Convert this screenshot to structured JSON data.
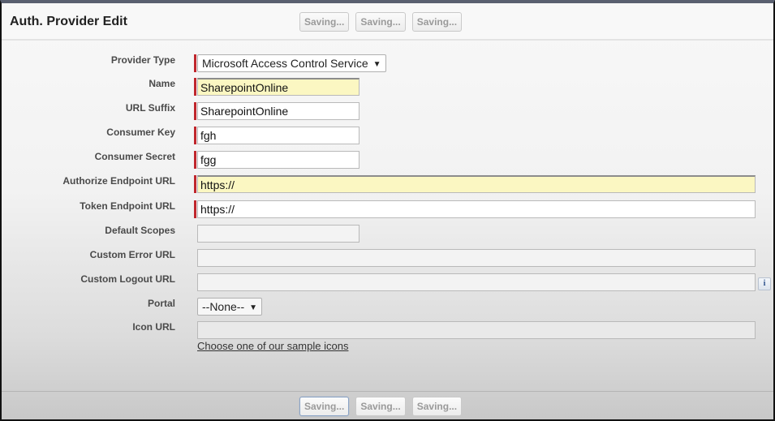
{
  "header": {
    "title": "Auth. Provider Edit",
    "buttons": [
      "Saving...",
      "Saving...",
      "Saving..."
    ]
  },
  "footer": {
    "buttons": [
      "Saving...",
      "Saving...",
      "Saving..."
    ]
  },
  "form": {
    "provider_type": {
      "label": "Provider Type",
      "value": "Microsoft Access Control Service",
      "required": true
    },
    "name": {
      "label": "Name",
      "value": "SharepointOnline",
      "required": true
    },
    "url_suffix": {
      "label": "URL Suffix",
      "value": "SharepointOnline",
      "required": true
    },
    "consumer_key": {
      "label": "Consumer Key",
      "value": "fgh",
      "required": true
    },
    "consumer_secret": {
      "label": "Consumer Secret",
      "value": "fgg",
      "required": true
    },
    "authorize_endpoint_url": {
      "label": "Authorize Endpoint URL",
      "value": "https://",
      "required": true
    },
    "token_endpoint_url": {
      "label": "Token Endpoint URL",
      "value": "https://",
      "required": true
    },
    "default_scopes": {
      "label": "Default Scopes",
      "value": ""
    },
    "custom_error_url": {
      "label": "Custom Error URL",
      "value": ""
    },
    "custom_logout_url": {
      "label": "Custom Logout URL",
      "value": "",
      "help_icon": "info-icon"
    },
    "portal": {
      "label": "Portal",
      "value": "--None--"
    },
    "icon_url": {
      "label": "Icon URL",
      "value": ""
    },
    "sample_icons_link": "Choose one of our sample icons"
  },
  "icons": {
    "dropdown": "triangle-down",
    "help": "i"
  },
  "colors": {
    "required_marker": "#c0272d",
    "highlight_field": "#fbf7c2",
    "button_text": "#9a9a9a"
  }
}
